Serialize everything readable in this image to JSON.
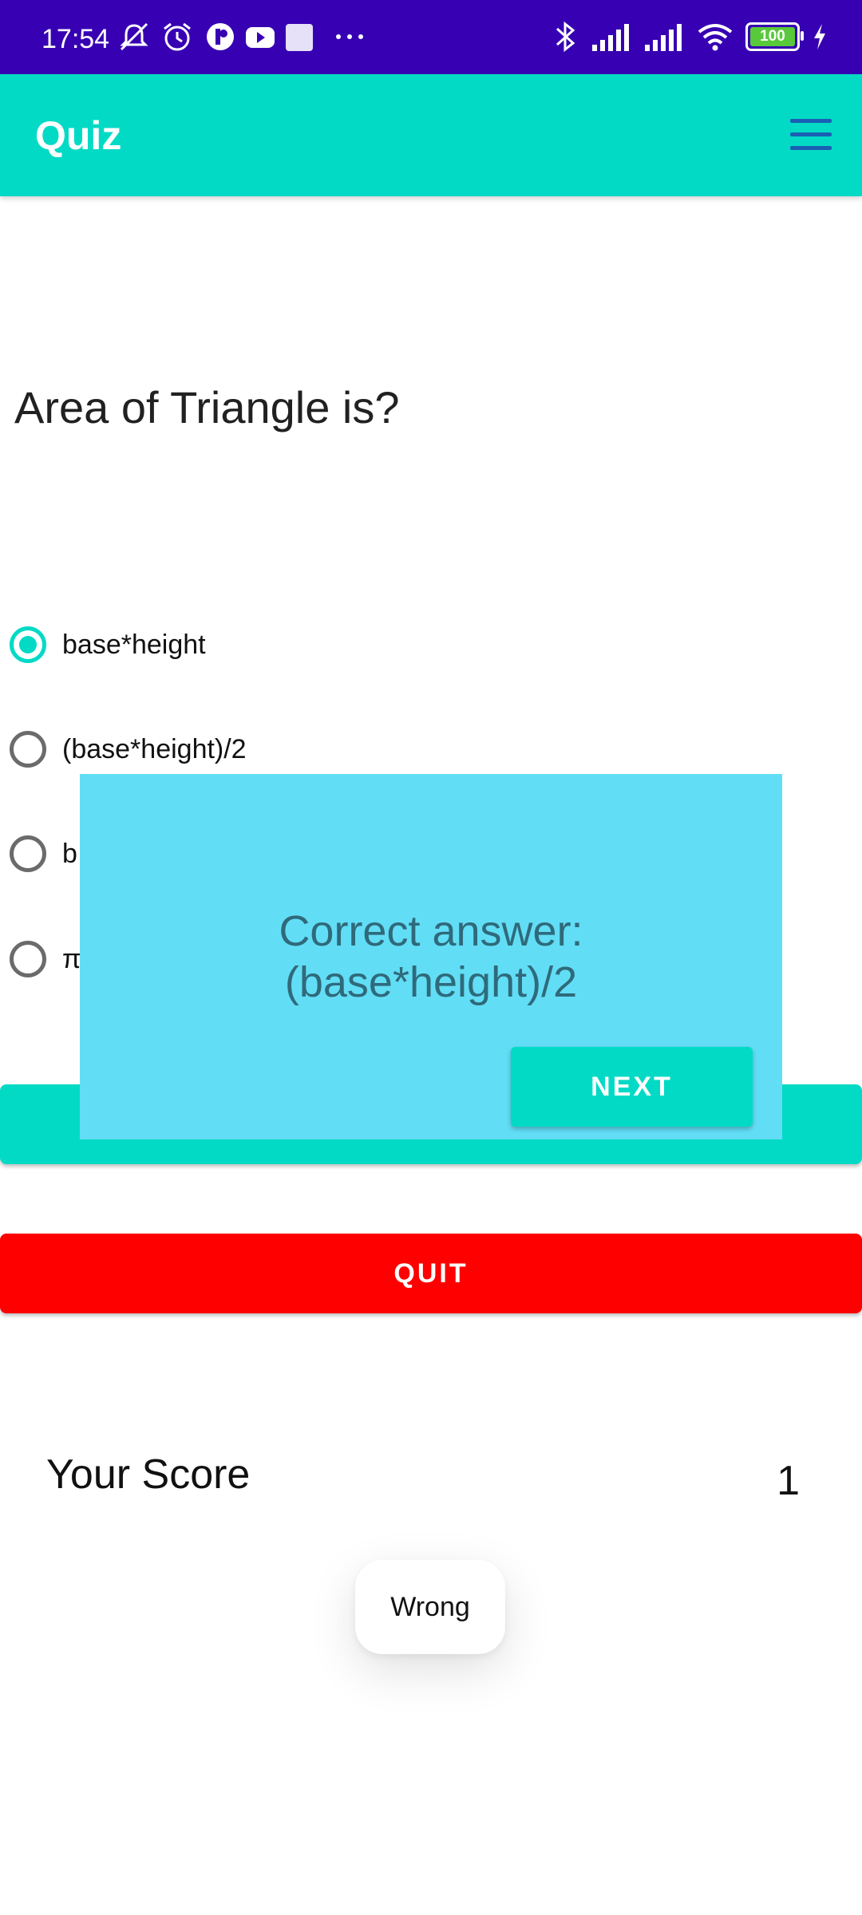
{
  "status_bar": {
    "time": "17:54",
    "battery": "100",
    "icons": [
      "mute-icon",
      "alarm-icon",
      "app-icon",
      "youtube-icon",
      "square-icon",
      "more-dots-icon",
      "bluetooth-icon",
      "signal-icon",
      "signal-icon",
      "wifi-icon",
      "battery-icon",
      "charging-icon"
    ]
  },
  "app_bar": {
    "title": "Quiz",
    "menu_icon": "hamburger-menu-icon"
  },
  "question": {
    "text": "Area of Triangle is?"
  },
  "options": [
    {
      "label": "base*height",
      "selected": true
    },
    {
      "label": "(base*height)/2",
      "selected": false
    },
    {
      "label": "b",
      "selected": false
    },
    {
      "label": "π",
      "selected": false
    }
  ],
  "buttons": {
    "quit": "QUIT"
  },
  "score": {
    "label": "Your Score",
    "value": "1"
  },
  "dialog": {
    "message_line1": "Correct answer:",
    "message_line2": "(base*height)/2",
    "next_label": "NEXT"
  },
  "toast": {
    "text": "Wrong"
  },
  "colors": {
    "status_bar": "#3700B3",
    "primary": "#03DAC5",
    "dialog_bg": "#62DDF6",
    "quit": "#FF0000"
  }
}
